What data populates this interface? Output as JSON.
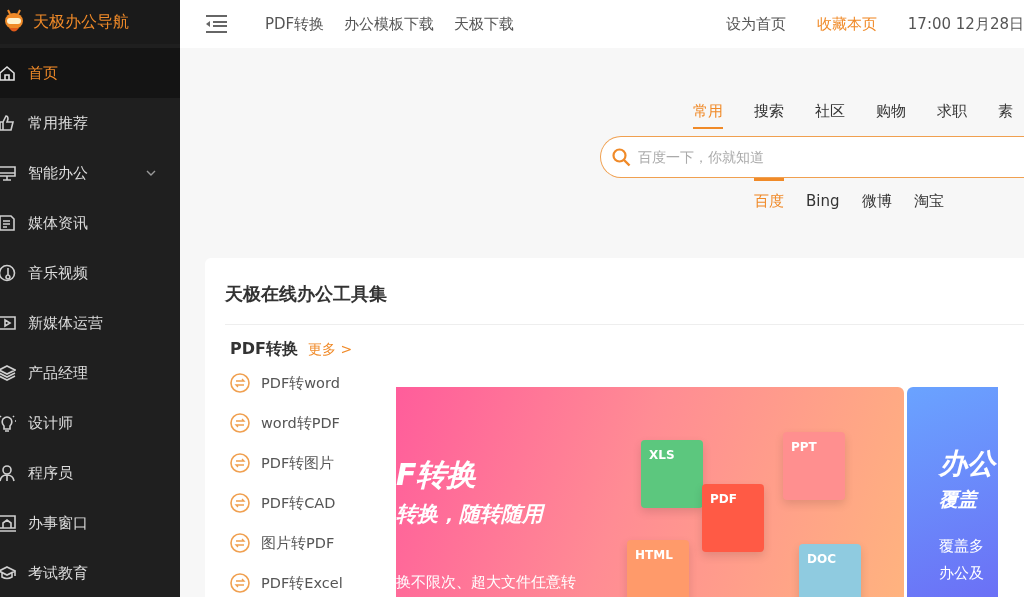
{
  "brand": {
    "name": "天极办公导航"
  },
  "sidebar": {
    "items": [
      {
        "label": "首页",
        "selected": true,
        "kind": "link"
      },
      {
        "label": "常用推荐",
        "selected": false,
        "kind": "link"
      },
      {
        "label": "智能办公",
        "selected": false,
        "kind": "submenu"
      },
      {
        "label": "媒体资讯",
        "selected": false,
        "kind": "link"
      },
      {
        "label": "音乐视频",
        "selected": false,
        "kind": "link"
      },
      {
        "label": "新媒体运营",
        "selected": false,
        "kind": "link"
      },
      {
        "label": "产品经理",
        "selected": false,
        "kind": "link"
      },
      {
        "label": "设计师",
        "selected": false,
        "kind": "link"
      },
      {
        "label": "程序员",
        "selected": false,
        "kind": "link"
      },
      {
        "label": "办事窗口",
        "selected": false,
        "kind": "link"
      },
      {
        "label": "考试教育",
        "selected": false,
        "kind": "link"
      }
    ]
  },
  "header": {
    "nav_links": [
      "PDF转换",
      "办公模板下载",
      "天极下载"
    ],
    "actions": [
      {
        "label": "设为首页",
        "highlighted": false
      },
      {
        "label": "收藏本页",
        "highlighted": true
      }
    ],
    "datetime": "17:00 12月28日"
  },
  "search": {
    "tabs": [
      {
        "label": "常用",
        "selected": true
      },
      {
        "label": "搜索",
        "selected": false
      },
      {
        "label": "社区",
        "selected": false
      },
      {
        "label": "购物",
        "selected": false
      },
      {
        "label": "求职",
        "selected": false
      },
      {
        "label": "素",
        "selected": false
      }
    ],
    "placeholder": "百度一下，你就知道",
    "engines": [
      {
        "label": "百度",
        "selected": true
      },
      {
        "label": "Bing",
        "selected": false
      },
      {
        "label": "微博",
        "selected": false
      },
      {
        "label": "淘宝",
        "selected": false
      }
    ]
  },
  "tool_card": {
    "title": "天极在线办公工具集",
    "section": {
      "title": "PDF转换",
      "more": "更多 >"
    },
    "items": [
      "PDF转word",
      "word转PDF",
      "PDF转图片",
      "PDF转CAD",
      "图片转PDF",
      "PDF转Excel"
    ],
    "banners": [
      {
        "kind": "conversion",
        "title": "F转换",
        "subtitle": "转换，随转随用",
        "lines": [
          "换不限次、超大文件任意转"
        ],
        "files": [
          "XLS",
          "PPT",
          "PDF",
          "HTML",
          "DOC"
        ]
      },
      {
        "kind": "office",
        "title": "办公",
        "subtitle": "覆盖",
        "lines": [
          "覆盖多",
          "办公及"
        ]
      }
    ]
  }
}
